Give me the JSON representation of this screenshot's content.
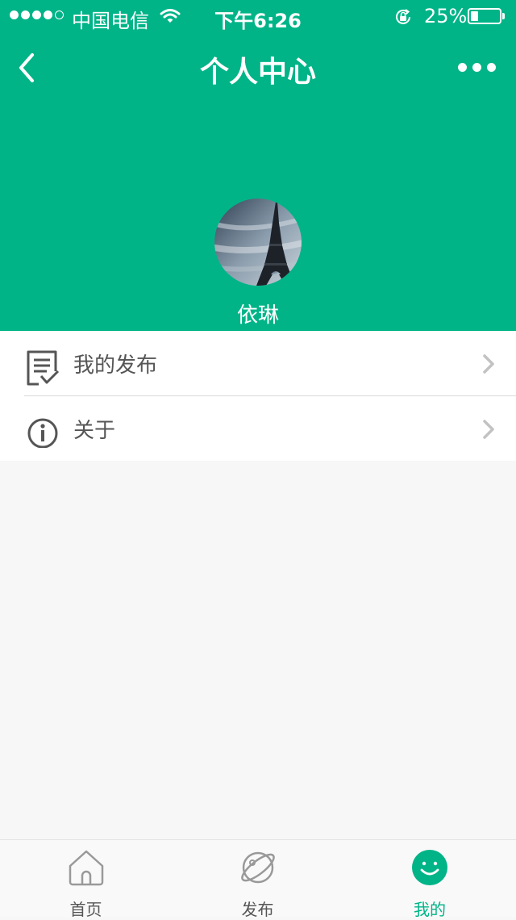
{
  "status_bar": {
    "carrier": "中国电信",
    "time": "下午6:26",
    "battery_percent": "25%",
    "battery_level": 0.25,
    "signal_bars": 4
  },
  "nav": {
    "title": "个人中心",
    "icons": {
      "back": "chevron-left-icon",
      "more": "more-dots-icon"
    }
  },
  "profile": {
    "username": "依琳",
    "avatar": "eiffel-tower-photo"
  },
  "menu": {
    "items": [
      {
        "label": "我的发布",
        "icon": "document-check-icon"
      },
      {
        "label": "关于",
        "icon": "info-icon"
      }
    ]
  },
  "tabbar": {
    "tabs": [
      {
        "label": "首页",
        "icon": "home-icon"
      },
      {
        "label": "发布",
        "icon": "planet-icon"
      },
      {
        "label": "我的",
        "icon": "smile-icon",
        "active": true
      }
    ]
  },
  "colors": {
    "brand": "#00b488",
    "background": "#f7f7f7",
    "text": "#555555"
  }
}
